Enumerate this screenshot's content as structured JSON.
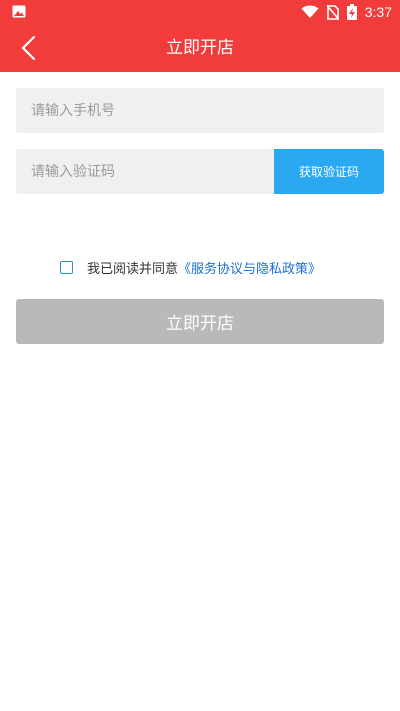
{
  "status_bar": {
    "time": "3:37",
    "icons": [
      "image-icon",
      "wifi-icon",
      "no-sim-icon",
      "battery-charging-icon"
    ]
  },
  "header": {
    "title": "立即开店",
    "back_icon": "back-arrow-icon",
    "color": "#f23c3c"
  },
  "form": {
    "phone_placeholder": "请输入手机号",
    "code_placeholder": "请输入验证码",
    "get_code_label": "获取验证码",
    "get_code_color": "#2aa8f2"
  },
  "agreement": {
    "text": "我已阅读并同意",
    "link": "《服务协议与隐私政策》",
    "checked": false
  },
  "submit": {
    "label": "立即开店",
    "color": "#b9b9b9"
  }
}
